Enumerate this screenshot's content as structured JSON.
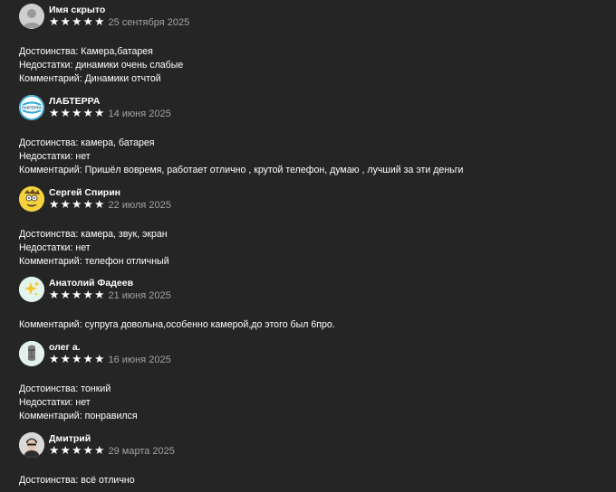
{
  "reviews": [
    {
      "author": "Имя скрыто",
      "avatar": "person-silhouette",
      "stars": [
        "★",
        "★",
        "★",
        "★",
        "★"
      ],
      "date": "25 сентября 2025",
      "lines": [
        "Достоинства: Камера,батарея",
        "Недостатки: динамики очень слабые",
        "Комментарий: Динамики отчтой"
      ]
    },
    {
      "author": "ЛАБТЕРРА",
      "avatar": "labterra-logo",
      "avatar_text": "ЛАБТЕРРА",
      "stars": [
        "★",
        "★",
        "★",
        "★",
        "★"
      ],
      "date": "14 июня 2025",
      "lines": [
        "Достоинства: камера, батарея",
        "Недостатки: нет",
        "Комментарий: Пришёл вовремя, работает отлично , крутой телефон, думаю , лучший за эти деньги"
      ]
    },
    {
      "author": "Сергей Спирин",
      "avatar": "cartoon-face",
      "stars": [
        "★",
        "★",
        "★",
        "★",
        "★"
      ],
      "date": "22 июля 2025",
      "lines": [
        "Достоинства: камера, звук, экран",
        "Недостатки: нет",
        "Комментарий: телефон отличный"
      ]
    },
    {
      "author": "Анатолий Фадеев",
      "avatar": "sparkles",
      "stars": [
        "★",
        "★",
        "★",
        "★",
        "★"
      ],
      "date": "21 июня 2025",
      "lines": [
        "Комментарий: супруга довольна,особенно камерой,до этого был 6про."
      ]
    },
    {
      "author": "олег а.",
      "avatar": "moai-statue",
      "stars": [
        "★",
        "★",
        "★",
        "★",
        "★"
      ],
      "date": "16 июня 2025",
      "lines": [
        "Достоинства: тонкий",
        "Недостатки: нет",
        "Комментарий: понравился"
      ]
    },
    {
      "author": "Дмитрий",
      "avatar": "person-photo",
      "stars": [
        "★",
        "★",
        "★",
        "★",
        "★"
      ],
      "date": "29 марта 2025",
      "lines": [
        "Достоинства: всё отлично"
      ]
    }
  ],
  "colors": {
    "background": "#252525",
    "text": "#ffffff",
    "date": "#a3a3a3",
    "stars": "#ffffff"
  }
}
